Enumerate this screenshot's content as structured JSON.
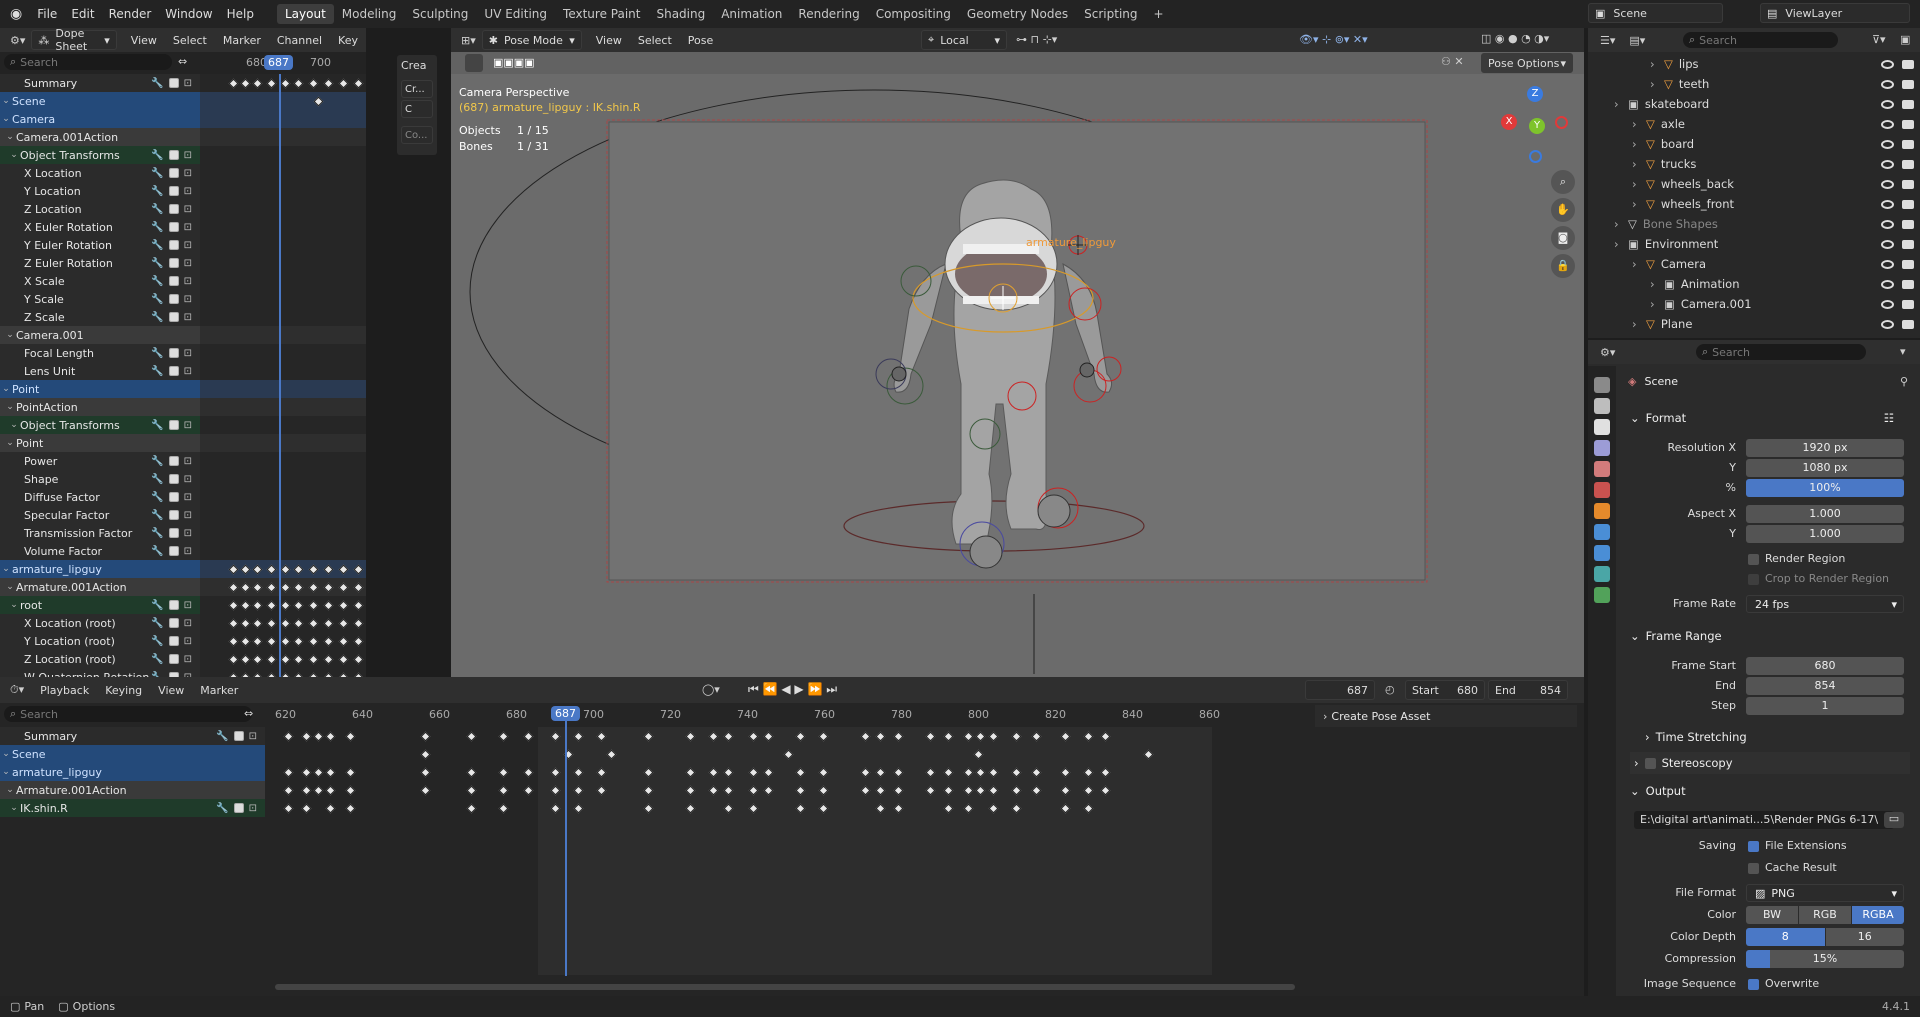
{
  "topmenu": {
    "items": [
      "File",
      "Edit",
      "Render",
      "Window",
      "Help"
    ],
    "workspaces": [
      "Layout",
      "Modeling",
      "Sculpting",
      "UV Editing",
      "Texture Paint",
      "Shading",
      "Animation",
      "Rendering",
      "Compositing",
      "Geometry Nodes",
      "Scripting"
    ],
    "scene": "Scene",
    "view_layer": "ViewLayer"
  },
  "dopesheet": {
    "editor": "Dope Sheet",
    "menus": [
      "View",
      "Select",
      "Marker",
      "Channel",
      "Key"
    ],
    "search_placeholder": "Search",
    "ruler": [
      "680",
      "687",
      "700"
    ],
    "side_tab": "Crea",
    "side_btns": [
      "Cr...",
      "C",
      "Co..."
    ],
    "channels": [
      {
        "label": "Summary",
        "kind": "plain"
      },
      {
        "label": "Scene",
        "kind": "obj"
      },
      {
        "label": "Camera",
        "kind": "obj"
      },
      {
        "label": "Camera.001Action",
        "kind": "act"
      },
      {
        "label": "Object Transforms",
        "kind": "grp"
      },
      {
        "label": "X Location",
        "kind": "plain"
      },
      {
        "label": "Y Location",
        "kind": "plain"
      },
      {
        "label": "Z Location",
        "kind": "plain"
      },
      {
        "label": "X Euler Rotation",
        "kind": "plain"
      },
      {
        "label": "Y Euler Rotation",
        "kind": "plain"
      },
      {
        "label": "Z Euler Rotation",
        "kind": "plain"
      },
      {
        "label": "X Scale",
        "kind": "plain"
      },
      {
        "label": "Y Scale",
        "kind": "plain"
      },
      {
        "label": "Z Scale",
        "kind": "plain"
      },
      {
        "label": "Camera.001",
        "kind": "act"
      },
      {
        "label": "Focal Length",
        "kind": "plain"
      },
      {
        "label": "Lens Unit",
        "kind": "plain"
      },
      {
        "label": "Point",
        "kind": "obj"
      },
      {
        "label": "PointAction",
        "kind": "act"
      },
      {
        "label": "Object Transforms",
        "kind": "grp"
      },
      {
        "label": "Point",
        "kind": "act"
      },
      {
        "label": "Power",
        "kind": "plain"
      },
      {
        "label": "Shape",
        "kind": "plain"
      },
      {
        "label": "Diffuse Factor",
        "kind": "plain"
      },
      {
        "label": "Specular Factor",
        "kind": "plain"
      },
      {
        "label": "Transmission Factor",
        "kind": "plain"
      },
      {
        "label": "Volume Factor",
        "kind": "plain"
      },
      {
        "label": "armature_lipguy",
        "kind": "obj"
      },
      {
        "label": "Armature.001Action",
        "kind": "act"
      },
      {
        "label": "root",
        "kind": "grp"
      },
      {
        "label": "X Location (root)",
        "kind": "plain"
      },
      {
        "label": "Y Location (root)",
        "kind": "plain"
      },
      {
        "label": "Z Location (root)",
        "kind": "plain"
      },
      {
        "label": "W Quaternion Rotation",
        "kind": "plain"
      }
    ]
  },
  "viewport": {
    "mode": "Pose Mode",
    "menus": [
      "View",
      "Select",
      "Pose"
    ],
    "orientation": "Local",
    "pose_options": "Pose Options",
    "camera_label": "Camera Perspective",
    "active_label": "(687) armature_lipguy : IK.shin.R",
    "stats": [
      {
        "k": "Objects",
        "v": "1 / 15"
      },
      {
        "k": "Bones",
        "v": "1 / 31"
      }
    ],
    "armature_name": "armature_lipguy",
    "axes": {
      "z": "Z",
      "y": "Y",
      "x": "X"
    }
  },
  "timeline": {
    "menus": [
      "Playback",
      "Keying",
      "View",
      "Marker"
    ],
    "search_placeholder": "Search",
    "current": "687",
    "start_label": "Start",
    "start": "680",
    "end_label": "End",
    "end": "854",
    "ruler": [
      "620",
      "640",
      "660",
      "680",
      "700",
      "720",
      "740",
      "760",
      "780",
      "800",
      "820",
      "840",
      "860"
    ],
    "create_pose_asset": "Create Pose Asset",
    "channels": [
      {
        "label": "Summary",
        "kind": "plain"
      },
      {
        "label": "Scene",
        "kind": "obj"
      },
      {
        "label": "armature_lipguy",
        "kind": "obj"
      },
      {
        "label": "Armature.001Action",
        "kind": "act"
      },
      {
        "label": "IK.shin.R",
        "kind": "grp"
      }
    ]
  },
  "outliner": {
    "search_placeholder": "Search",
    "rows": [
      {
        "label": "lips",
        "indent": 3,
        "color": "o"
      },
      {
        "label": "teeth",
        "indent": 3,
        "color": "o"
      },
      {
        "label": "skateboard",
        "indent": 1,
        "color": "w"
      },
      {
        "label": "axle",
        "indent": 2,
        "color": "o"
      },
      {
        "label": "board",
        "indent": 2,
        "color": "o"
      },
      {
        "label": "trucks",
        "indent": 2,
        "color": "o"
      },
      {
        "label": "wheels_back",
        "indent": 2,
        "color": "o"
      },
      {
        "label": "wheels_front",
        "indent": 2,
        "color": "o"
      },
      {
        "label": "Bone Shapes",
        "indent": 1,
        "color": "dim"
      },
      {
        "label": "Environment",
        "indent": 1,
        "color": "w"
      },
      {
        "label": "Camera",
        "indent": 2,
        "color": "o"
      },
      {
        "label": "Animation",
        "indent": 3,
        "color": "w"
      },
      {
        "label": "Camera.001",
        "indent": 3,
        "color": "w"
      },
      {
        "label": "Plane",
        "indent": 2,
        "color": "o"
      }
    ]
  },
  "properties": {
    "search_placeholder": "Search",
    "context": "Scene",
    "format": "Format",
    "res_x_label": "Resolution X",
    "res_x": "1920 px",
    "res_y_label": "Y",
    "res_y": "1080 px",
    "pct_label": "%",
    "pct": "100%",
    "aspect_x_label": "Aspect X",
    "aspect_x": "1.000",
    "aspect_y_label": "Y",
    "aspect_y": "1.000",
    "render_region": "Render Region",
    "crop": "Crop to Render Region",
    "frame_rate_label": "Frame Rate",
    "frame_rate": "24 fps",
    "frame_range": "Frame Range",
    "frame_start_label": "Frame Start",
    "frame_start": "680",
    "end_label": "End",
    "end": "854",
    "step_label": "Step",
    "step": "1",
    "time_stretching": "Time Stretching",
    "stereoscopy": "Stereoscopy",
    "output": "Output",
    "output_path": "E:\\digital art\\animati...5\\Render PNGs 6-17\\",
    "saving_label": "Saving",
    "file_ext": "File Extensions",
    "cache": "Cache Result",
    "file_format_label": "File Format",
    "file_format": "PNG",
    "color_label": "Color",
    "color_opts": [
      "BW",
      "RGB",
      "RGBA"
    ],
    "depth_label": "Color Depth",
    "depth_opts": [
      "8",
      "16"
    ],
    "compression_label": "Compression",
    "compression": "15%",
    "image_seq_label": "Image Sequence",
    "overwrite": "Overwrite"
  },
  "statusbar": {
    "pan": "Pan",
    "options": "Options",
    "version": "4.4.1"
  },
  "colors": {
    "accent": "#4a78c6",
    "selected_row": "#2d5082",
    "object_row": "#244a7a",
    "cursor": "#4a78c6",
    "viewport_bg": "#6b6b6b"
  }
}
